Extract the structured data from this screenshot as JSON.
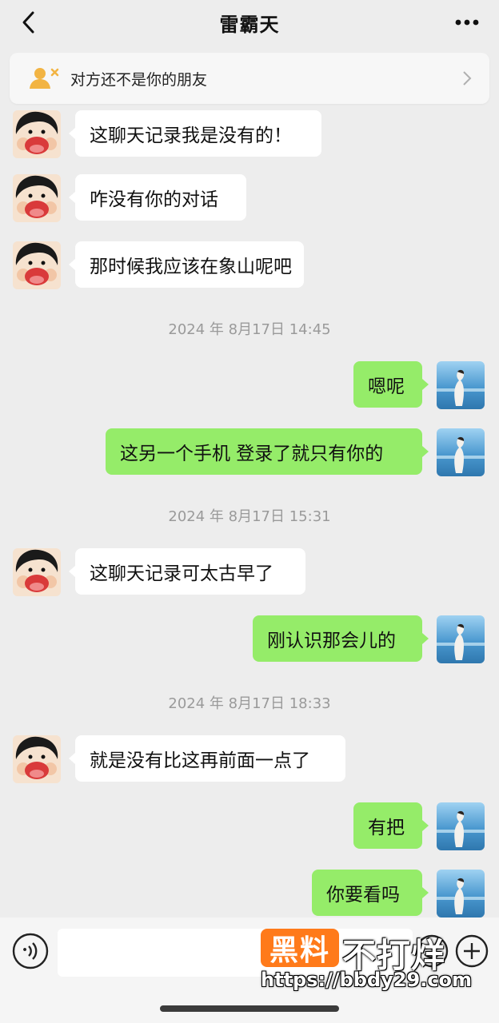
{
  "header": {
    "title": "雷霸天"
  },
  "notice": {
    "text": "对方还不是你的朋友"
  },
  "messages": [
    {
      "side": "in",
      "text": "这聊天记录我是没有的！"
    },
    {
      "side": "in",
      "text": "咋没有你的对话"
    },
    {
      "side": "in",
      "text": "那时候我应该在象山呢吧"
    },
    {
      "side": "time",
      "text": "2024 年 8月17日 14:45"
    },
    {
      "side": "out",
      "text": "嗯呢"
    },
    {
      "side": "out",
      "text": "这另一个手机 登录了就只有你的"
    },
    {
      "side": "time",
      "text": "2024 年 8月17日 15:31"
    },
    {
      "side": "in",
      "text": "这聊天记录可太古早了"
    },
    {
      "side": "out",
      "text": "刚认识那会儿的"
    },
    {
      "side": "time",
      "text": "2024 年 8月17日 18:33"
    },
    {
      "side": "in",
      "text": "就是没有比这再前面一点了"
    },
    {
      "side": "out",
      "text": "有把"
    },
    {
      "side": "out",
      "text": "你要看吗"
    }
  ],
  "watermark": {
    "badge": "黑料",
    "big": "不打烊",
    "url": "https://bbdy29.com"
  },
  "icons": {
    "back": "chevron-left-icon",
    "more": "more-dots-icon",
    "notice": "user-unfriended-icon",
    "voice": "voice-icon",
    "emoji": "emoji-icon",
    "plus": "plus-icon"
  },
  "colors": {
    "outgoing_bubble": "#95ec69",
    "incoming_bubble": "#ffffff",
    "background": "#ededed",
    "notice_icon": "#f2b443"
  }
}
